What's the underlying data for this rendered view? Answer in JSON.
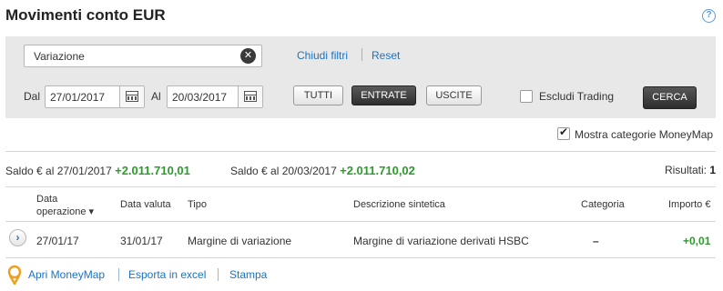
{
  "page": {
    "title": "Movimenti conto EUR",
    "help": "?"
  },
  "filters": {
    "search_value": "Variazione",
    "clear_glyph": "✕",
    "close_filters_link": "Chiudi filtri",
    "reset_link": "Reset",
    "from_label": "Dal",
    "from_date": "27/01/2017",
    "to_label": "Al",
    "to_date": "20/03/2017",
    "buttons": {
      "all": "TUTTI",
      "income": "ENTRATE",
      "outgoing": "USCITE"
    },
    "selected_filter": "ENTRATE",
    "exclude_trading_label": "Escludi Trading",
    "exclude_trading_checked": false,
    "search_button": "CERCA"
  },
  "options": {
    "show_moneymap_label": "Mostra categorie MoneyMap",
    "show_moneymap_checked": true,
    "check_glyph": "✔"
  },
  "summary": {
    "saldo_start_label": "Saldo € al 27/01/2017",
    "saldo_start_value": "+2.011.710,01",
    "saldo_end_label": "Saldo € al 20/03/2017",
    "saldo_end_value": "+2.011.710,02",
    "results_label": "Risultati:",
    "results_count": "1"
  },
  "table": {
    "headers": {
      "data_operazione_line1": "Data",
      "data_operazione_line2": "operazione",
      "sort_glyph": "▾",
      "data_valuta": "Data valuta",
      "tipo": "Tipo",
      "descrizione": "Descrizione sintetica",
      "categoria": "Categoria",
      "importo": "Importo €"
    },
    "rows": [
      {
        "expand_glyph": "›",
        "data_operazione": "27/01/17",
        "data_valuta": "31/01/17",
        "tipo": "Margine di variazione",
        "descrizione": "Margine di variazione derivati HSBC",
        "categoria": "–",
        "importo": "+0,01"
      }
    ]
  },
  "footer": {
    "moneymap_link": "Apri MoneyMap",
    "excel_link": "Esporta in excel",
    "print_link": "Stampa"
  },
  "colors": {
    "accent_link": "#1a73c2",
    "positive": "#2e9a2e",
    "panel_bg": "#e8e8e8",
    "pin_orange": "#f0a020"
  }
}
